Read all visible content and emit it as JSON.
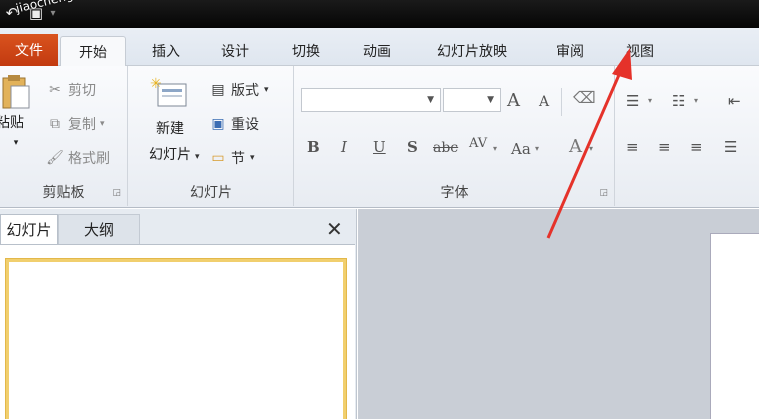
{
  "watermark": "jiaochengzhijia.com 教",
  "ribbon_tabs": {
    "file": "文件",
    "home": "开始",
    "insert": "插入",
    "design": "设计",
    "transitions": "切换",
    "animations": "动画",
    "slideshow": "幻灯片放映",
    "review": "审阅",
    "view": "视图"
  },
  "clipboard": {
    "paste": "粘贴",
    "cut": "剪切",
    "copy": "复制",
    "format_painter": "格式刷",
    "label": "剪贴板"
  },
  "slides": {
    "new_slide_line1": "新建",
    "new_slide_line2": "幻灯片",
    "layout": "版式",
    "reset": "重设",
    "section": "节",
    "label": "幻灯片"
  },
  "font": {
    "label": "字体",
    "grow": "A",
    "shrink": "A",
    "bold": "B",
    "italic": "I",
    "underline": "U",
    "shadow": "S",
    "strikethrough": "abc",
    "spacing": "AV",
    "change_case": "Aa",
    "font_color": "A"
  },
  "outline_panel": {
    "tab_slides": "幻灯片",
    "tab_outline": "大纲",
    "close": "✕"
  },
  "colors": {
    "file_tab": "#c8431a",
    "arrow": "#e5322a",
    "thumb_border": "#f1cf6e"
  }
}
